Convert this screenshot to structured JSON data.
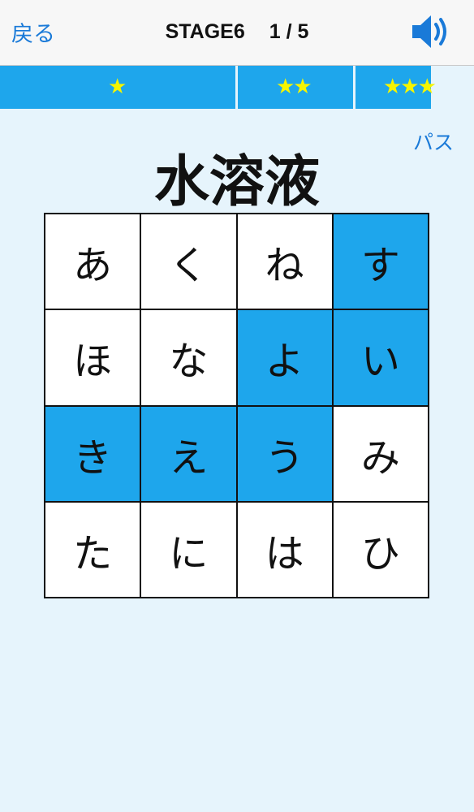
{
  "header": {
    "back_label": "戻る",
    "stage_label": "STAGE6",
    "progress_label": "1 / 5",
    "sound_icon": "speaker-volume-icon"
  },
  "progress": {
    "fill_fraction": 0.91,
    "thresholds": [
      {
        "stars": "★"
      },
      {
        "stars": "★★"
      },
      {
        "stars": "★★★"
      }
    ]
  },
  "pass_label": "パス",
  "question_word": "水溶液",
  "grid": {
    "cells": [
      {
        "char": "あ",
        "selected": false
      },
      {
        "char": "く",
        "selected": false
      },
      {
        "char": "ね",
        "selected": false
      },
      {
        "char": "す",
        "selected": true
      },
      {
        "char": "ほ",
        "selected": false
      },
      {
        "char": "な",
        "selected": false
      },
      {
        "char": "よ",
        "selected": true
      },
      {
        "char": "い",
        "selected": true
      },
      {
        "char": "き",
        "selected": true
      },
      {
        "char": "え",
        "selected": true
      },
      {
        "char": "う",
        "selected": true
      },
      {
        "char": "み",
        "selected": false
      },
      {
        "char": "た",
        "selected": false
      },
      {
        "char": "に",
        "selected": false
      },
      {
        "char": "は",
        "selected": false
      },
      {
        "char": "ひ",
        "selected": false
      }
    ]
  },
  "colors": {
    "accent": "#1ea6ec",
    "star": "#f5f500",
    "link": "#1a7ad8",
    "background": "#e6f4fc"
  }
}
